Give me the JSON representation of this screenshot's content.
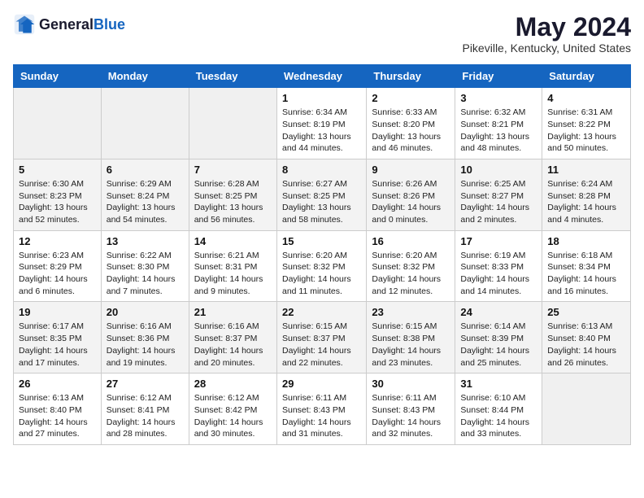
{
  "header": {
    "logo_general": "General",
    "logo_blue": "Blue",
    "month_year": "May 2024",
    "location": "Pikeville, Kentucky, United States"
  },
  "weekdays": [
    "Sunday",
    "Monday",
    "Tuesday",
    "Wednesday",
    "Thursday",
    "Friday",
    "Saturday"
  ],
  "weeks": [
    [
      {
        "day": "",
        "sunrise": "",
        "sunset": "",
        "daylight": "",
        "empty": true
      },
      {
        "day": "",
        "sunrise": "",
        "sunset": "",
        "daylight": "",
        "empty": true
      },
      {
        "day": "",
        "sunrise": "",
        "sunset": "",
        "daylight": "",
        "empty": true
      },
      {
        "day": "1",
        "sunrise": "Sunrise: 6:34 AM",
        "sunset": "Sunset: 8:19 PM",
        "daylight": "Daylight: 13 hours and 44 minutes.",
        "empty": false
      },
      {
        "day": "2",
        "sunrise": "Sunrise: 6:33 AM",
        "sunset": "Sunset: 8:20 PM",
        "daylight": "Daylight: 13 hours and 46 minutes.",
        "empty": false
      },
      {
        "day": "3",
        "sunrise": "Sunrise: 6:32 AM",
        "sunset": "Sunset: 8:21 PM",
        "daylight": "Daylight: 13 hours and 48 minutes.",
        "empty": false
      },
      {
        "day": "4",
        "sunrise": "Sunrise: 6:31 AM",
        "sunset": "Sunset: 8:22 PM",
        "daylight": "Daylight: 13 hours and 50 minutes.",
        "empty": false
      }
    ],
    [
      {
        "day": "5",
        "sunrise": "Sunrise: 6:30 AM",
        "sunset": "Sunset: 8:23 PM",
        "daylight": "Daylight: 13 hours and 52 minutes.",
        "empty": false
      },
      {
        "day": "6",
        "sunrise": "Sunrise: 6:29 AM",
        "sunset": "Sunset: 8:24 PM",
        "daylight": "Daylight: 13 hours and 54 minutes.",
        "empty": false
      },
      {
        "day": "7",
        "sunrise": "Sunrise: 6:28 AM",
        "sunset": "Sunset: 8:25 PM",
        "daylight": "Daylight: 13 hours and 56 minutes.",
        "empty": false
      },
      {
        "day": "8",
        "sunrise": "Sunrise: 6:27 AM",
        "sunset": "Sunset: 8:25 PM",
        "daylight": "Daylight: 13 hours and 58 minutes.",
        "empty": false
      },
      {
        "day": "9",
        "sunrise": "Sunrise: 6:26 AM",
        "sunset": "Sunset: 8:26 PM",
        "daylight": "Daylight: 14 hours and 0 minutes.",
        "empty": false
      },
      {
        "day": "10",
        "sunrise": "Sunrise: 6:25 AM",
        "sunset": "Sunset: 8:27 PM",
        "daylight": "Daylight: 14 hours and 2 minutes.",
        "empty": false
      },
      {
        "day": "11",
        "sunrise": "Sunrise: 6:24 AM",
        "sunset": "Sunset: 8:28 PM",
        "daylight": "Daylight: 14 hours and 4 minutes.",
        "empty": false
      }
    ],
    [
      {
        "day": "12",
        "sunrise": "Sunrise: 6:23 AM",
        "sunset": "Sunset: 8:29 PM",
        "daylight": "Daylight: 14 hours and 6 minutes.",
        "empty": false
      },
      {
        "day": "13",
        "sunrise": "Sunrise: 6:22 AM",
        "sunset": "Sunset: 8:30 PM",
        "daylight": "Daylight: 14 hours and 7 minutes.",
        "empty": false
      },
      {
        "day": "14",
        "sunrise": "Sunrise: 6:21 AM",
        "sunset": "Sunset: 8:31 PM",
        "daylight": "Daylight: 14 hours and 9 minutes.",
        "empty": false
      },
      {
        "day": "15",
        "sunrise": "Sunrise: 6:20 AM",
        "sunset": "Sunset: 8:32 PM",
        "daylight": "Daylight: 14 hours and 11 minutes.",
        "empty": false
      },
      {
        "day": "16",
        "sunrise": "Sunrise: 6:20 AM",
        "sunset": "Sunset: 8:32 PM",
        "daylight": "Daylight: 14 hours and 12 minutes.",
        "empty": false
      },
      {
        "day": "17",
        "sunrise": "Sunrise: 6:19 AM",
        "sunset": "Sunset: 8:33 PM",
        "daylight": "Daylight: 14 hours and 14 minutes.",
        "empty": false
      },
      {
        "day": "18",
        "sunrise": "Sunrise: 6:18 AM",
        "sunset": "Sunset: 8:34 PM",
        "daylight": "Daylight: 14 hours and 16 minutes.",
        "empty": false
      }
    ],
    [
      {
        "day": "19",
        "sunrise": "Sunrise: 6:17 AM",
        "sunset": "Sunset: 8:35 PM",
        "daylight": "Daylight: 14 hours and 17 minutes.",
        "empty": false
      },
      {
        "day": "20",
        "sunrise": "Sunrise: 6:16 AM",
        "sunset": "Sunset: 8:36 PM",
        "daylight": "Daylight: 14 hours and 19 minutes.",
        "empty": false
      },
      {
        "day": "21",
        "sunrise": "Sunrise: 6:16 AM",
        "sunset": "Sunset: 8:37 PM",
        "daylight": "Daylight: 14 hours and 20 minutes.",
        "empty": false
      },
      {
        "day": "22",
        "sunrise": "Sunrise: 6:15 AM",
        "sunset": "Sunset: 8:37 PM",
        "daylight": "Daylight: 14 hours and 22 minutes.",
        "empty": false
      },
      {
        "day": "23",
        "sunrise": "Sunrise: 6:15 AM",
        "sunset": "Sunset: 8:38 PM",
        "daylight": "Daylight: 14 hours and 23 minutes.",
        "empty": false
      },
      {
        "day": "24",
        "sunrise": "Sunrise: 6:14 AM",
        "sunset": "Sunset: 8:39 PM",
        "daylight": "Daylight: 14 hours and 25 minutes.",
        "empty": false
      },
      {
        "day": "25",
        "sunrise": "Sunrise: 6:13 AM",
        "sunset": "Sunset: 8:40 PM",
        "daylight": "Daylight: 14 hours and 26 minutes.",
        "empty": false
      }
    ],
    [
      {
        "day": "26",
        "sunrise": "Sunrise: 6:13 AM",
        "sunset": "Sunset: 8:40 PM",
        "daylight": "Daylight: 14 hours and 27 minutes.",
        "empty": false
      },
      {
        "day": "27",
        "sunrise": "Sunrise: 6:12 AM",
        "sunset": "Sunset: 8:41 PM",
        "daylight": "Daylight: 14 hours and 28 minutes.",
        "empty": false
      },
      {
        "day": "28",
        "sunrise": "Sunrise: 6:12 AM",
        "sunset": "Sunset: 8:42 PM",
        "daylight": "Daylight: 14 hours and 30 minutes.",
        "empty": false
      },
      {
        "day": "29",
        "sunrise": "Sunrise: 6:11 AM",
        "sunset": "Sunset: 8:43 PM",
        "daylight": "Daylight: 14 hours and 31 minutes.",
        "empty": false
      },
      {
        "day": "30",
        "sunrise": "Sunrise: 6:11 AM",
        "sunset": "Sunset: 8:43 PM",
        "daylight": "Daylight: 14 hours and 32 minutes.",
        "empty": false
      },
      {
        "day": "31",
        "sunrise": "Sunrise: 6:10 AM",
        "sunset": "Sunset: 8:44 PM",
        "daylight": "Daylight: 14 hours and 33 minutes.",
        "empty": false
      },
      {
        "day": "",
        "sunrise": "",
        "sunset": "",
        "daylight": "",
        "empty": true
      }
    ]
  ]
}
